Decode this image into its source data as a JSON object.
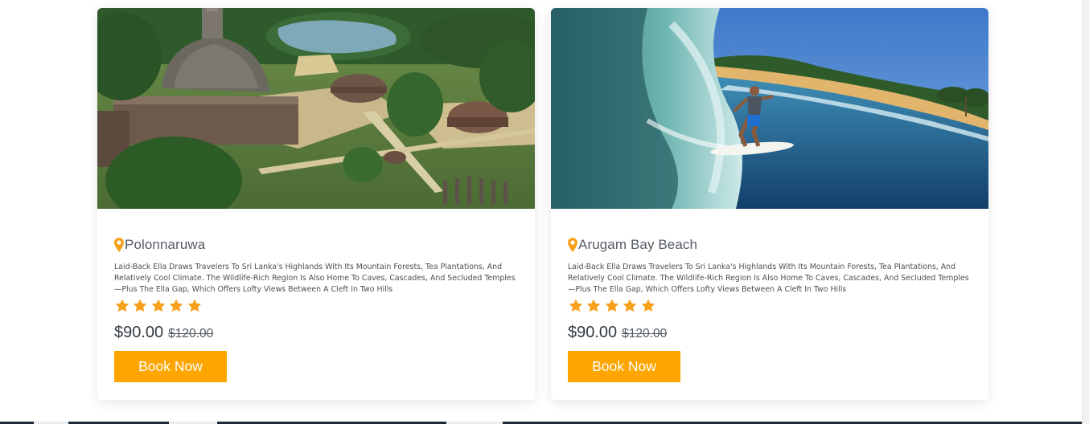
{
  "colors": {
    "accent": "#fea500",
    "star": "#f7a11a",
    "pin": "#f7a11a",
    "title_text": "#555b63",
    "body_text": "#4a4f55"
  },
  "cards": [
    {
      "image_alt": "Polonnaruwa ancient ruins aerial view",
      "title": "Polonnaruwa",
      "description": "Laid-Back Ella Draws Travelers To Sri Lanka's Highlands With Its Mountain Forests, Tea Plantations, And Relatively Cool Climate. The Wildlife-Rich Region Is Also Home To Caves, Cascades, And Secluded Temples—Plus The Ella Gap, Which Offers Lofty Views Between A Cleft In Two Hills",
      "rating": 5,
      "price": "$90.00",
      "old_price": "$120.00",
      "button_label": "Book Now",
      "pin_icon": "map-pin-icon",
      "star_icon": "star-icon"
    },
    {
      "image_alt": "Surfer riding a wave at Arugam Bay",
      "title": "Arugam Bay Beach",
      "description": "Laid-Back Ella Draws Travelers To Sri Lanka's Highlands With Its Mountain Forests, Tea Plantations, And Relatively Cool Climate. The Wildlife-Rich Region Is Also Home To Caves, Cascades, And Secluded Temples—Plus The Ella Gap, Which Offers Lofty Views Between A Cleft In Two Hills",
      "rating": 5,
      "price": "$90.00",
      "old_price": "$120.00",
      "button_label": "Book Now",
      "pin_icon": "map-pin-icon",
      "star_icon": "star-icon"
    }
  ]
}
